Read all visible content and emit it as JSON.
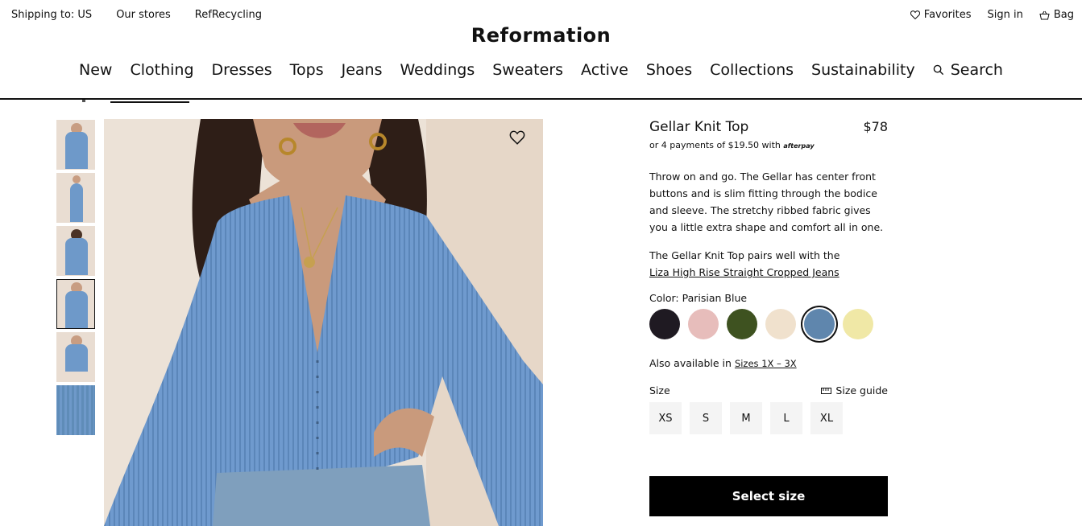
{
  "header": {
    "shipping": "Shipping to: US",
    "stores": "Our stores",
    "recycling": "RefRecycling",
    "favorites": "Favorites",
    "sign_in": "Sign in",
    "bag": "Bag",
    "logo": "Reformation"
  },
  "nav": {
    "items": [
      "New",
      "Clothing",
      "Dresses",
      "Tops",
      "Jeans",
      "Weddings",
      "Sweaters",
      "Active",
      "Shoes",
      "Collections",
      "Sustainability"
    ],
    "search": "Search"
  },
  "product": {
    "title": "Gellar Knit Top",
    "price": "$78",
    "payments": "or 4 payments of $19.50 with",
    "afterpay": "afterpay",
    "description": "Throw on and go. The Gellar has center front buttons and is slim fitting through the bodice and sleeve. The stretchy ribbed fabric gives you a little extra shape and comfort all in one.",
    "pairs_text": "The Gellar Knit Top pairs well with the",
    "pairs_link": "Liza High Rise Straight Cropped Jeans",
    "color_label": "Color: Parisian Blue",
    "colors": [
      "#1f1a22",
      "#e7bdbb",
      "#3e5220",
      "#f0e1cd",
      "#5f86ad",
      "#f0e8a6"
    ],
    "selected_color_index": 4,
    "also_text": "Also available in",
    "also_link": "Sizes 1X – 3X",
    "size_label": "Size",
    "size_guide": "Size guide",
    "sizes": [
      "XS",
      "S",
      "M",
      "L",
      "XL"
    ],
    "cta": "Select size"
  },
  "gallery": {
    "thumb_count": 6,
    "active_thumb_index": 3
  }
}
